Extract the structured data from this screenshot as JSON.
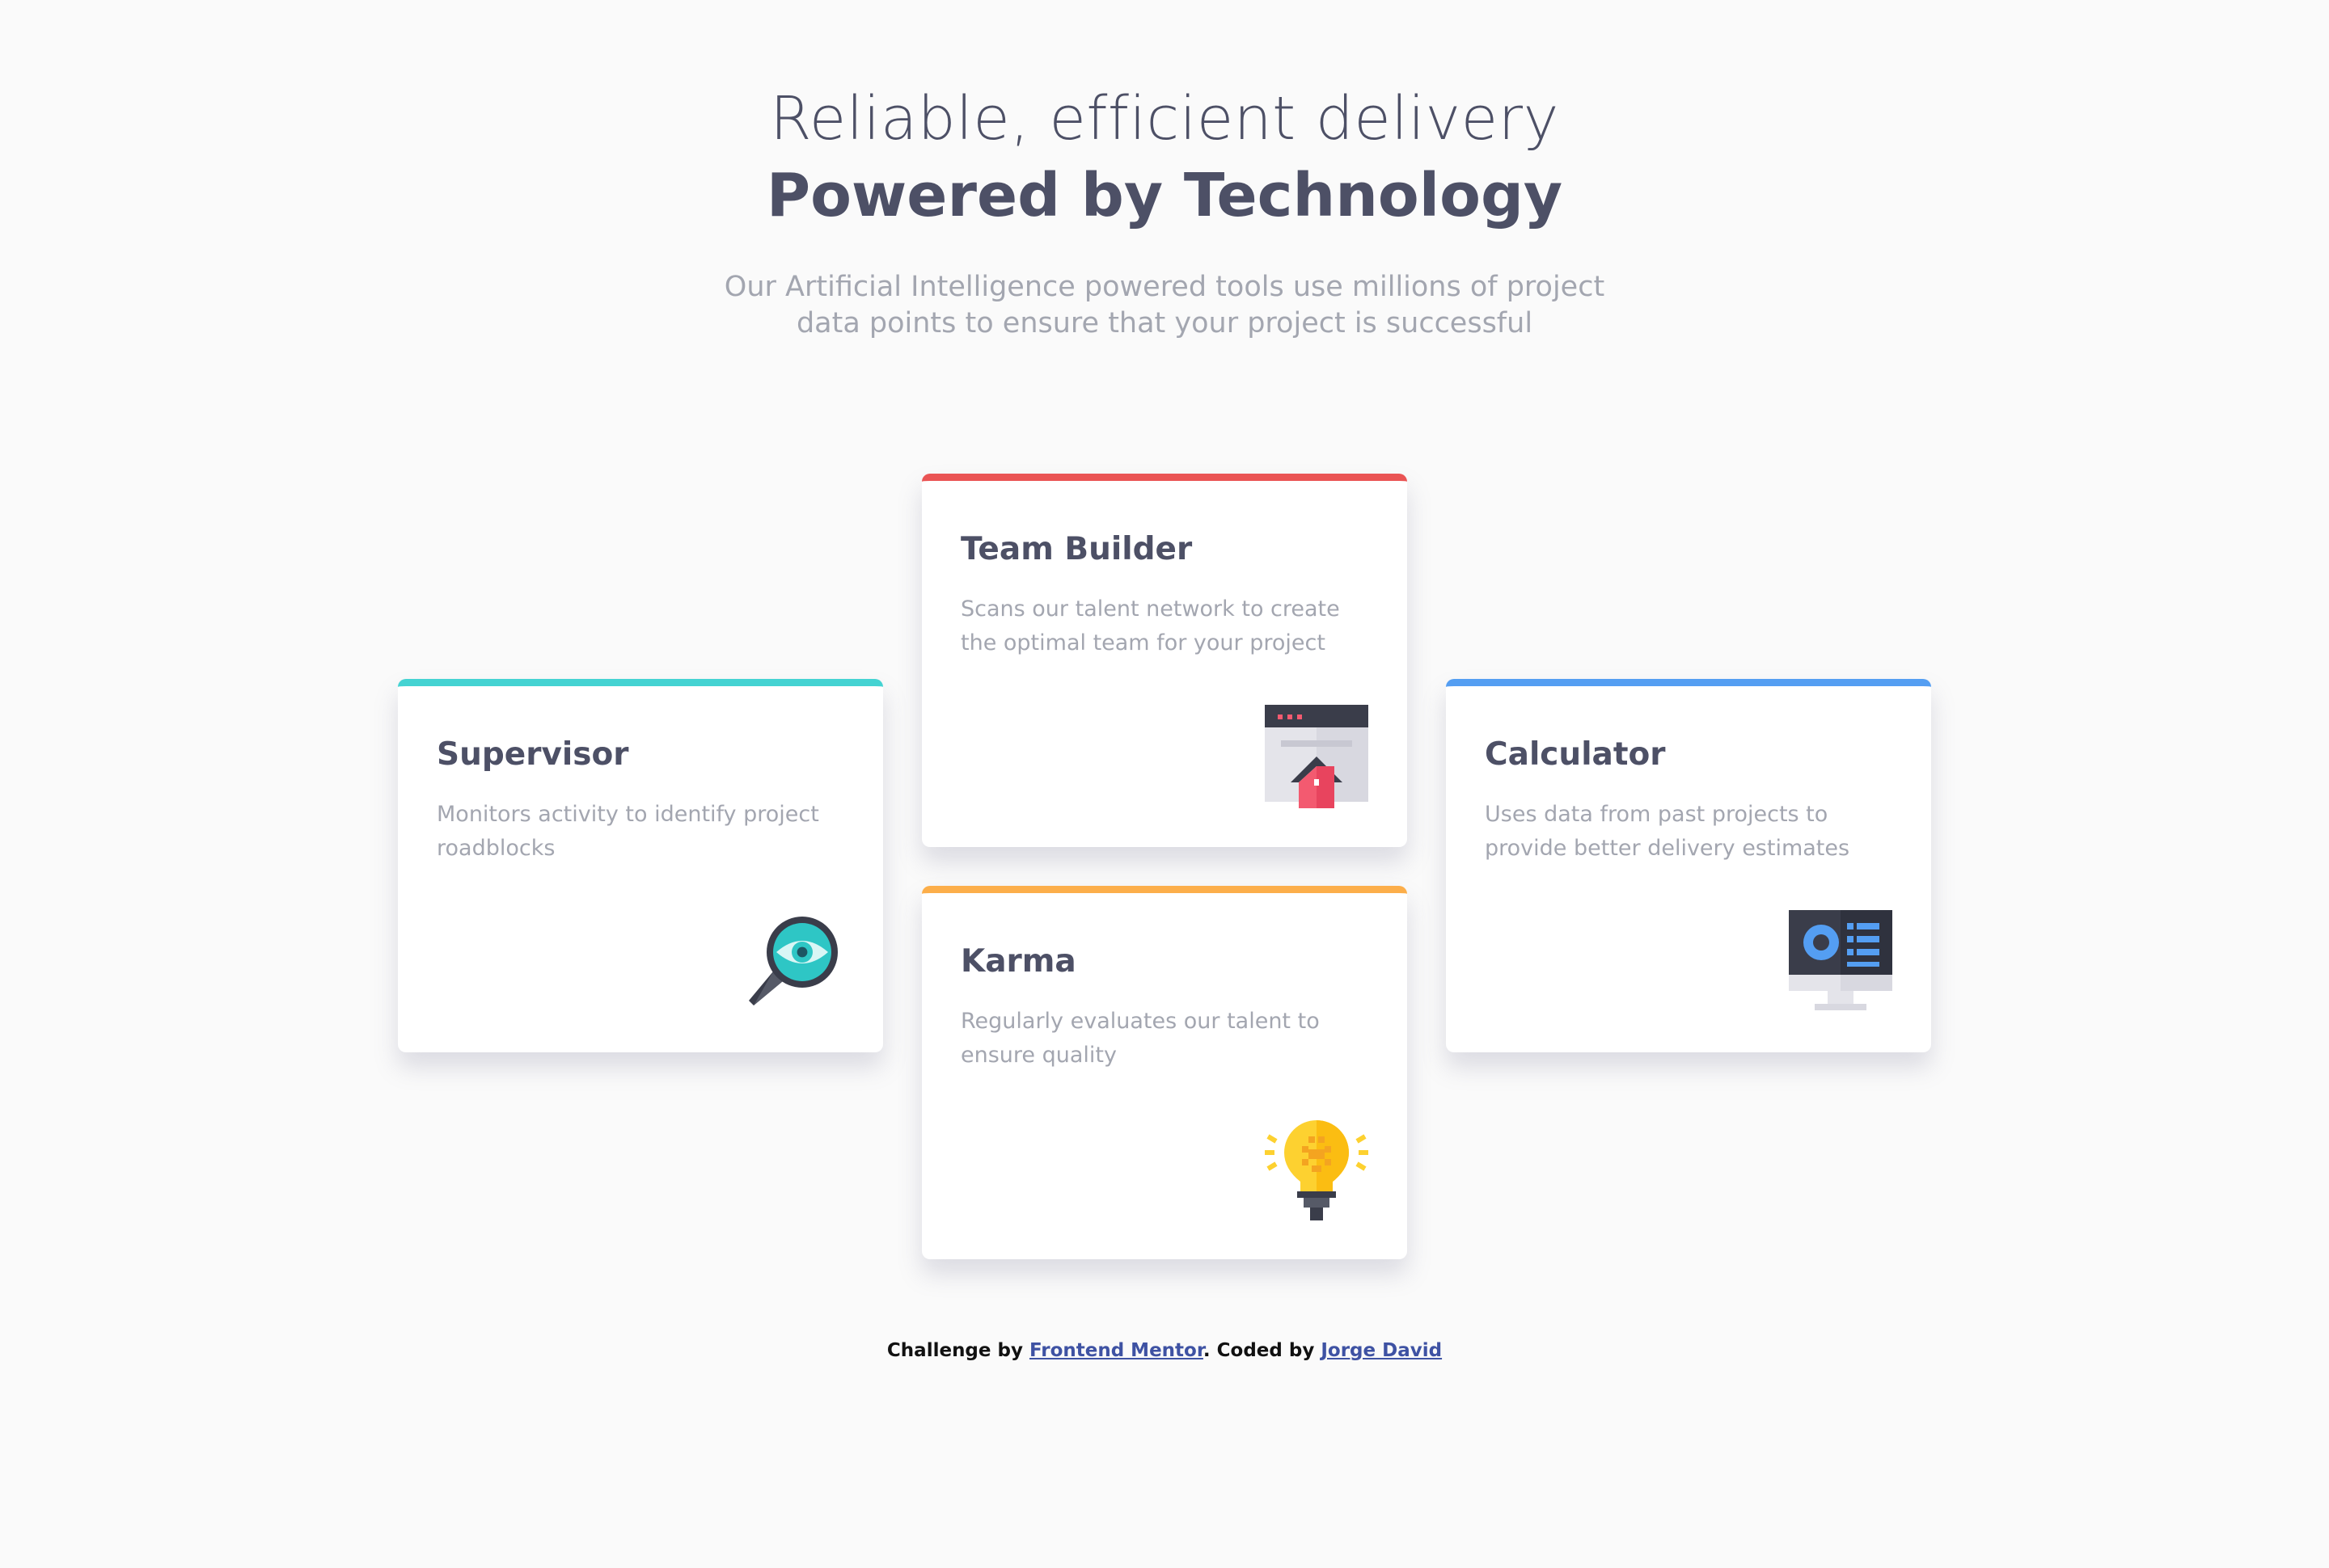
{
  "header": {
    "line1": "Reliable, efficient delivery",
    "line2": "Powered by Technology",
    "intro": "Our Artificial Intelligence powered tools use millions of project data points to ensure that your project is successful"
  },
  "cards": {
    "supervisor": {
      "title": "Supervisor",
      "description": "Monitors activity to identify project roadblocks",
      "icon": "magnifier-eye-icon",
      "accent": "#44d3d2"
    },
    "team_builder": {
      "title": "Team Builder",
      "description": "Scans our talent network to create the optimal team for your project",
      "icon": "window-house-icon",
      "accent": "#ea5454"
    },
    "karma": {
      "title": "Karma",
      "description": "Regularly evaluates our talent to ensure quality",
      "icon": "lightbulb-icon",
      "accent": "#fcae4a"
    },
    "calculator": {
      "title": "Calculator",
      "description": "Uses data from past projects to provide better delivery estimates",
      "icon": "monitor-dashboard-icon",
      "accent": "#549ef2"
    }
  },
  "footer": {
    "prefix": "Challenge by ",
    "link1": "Frontend Mentor",
    "middle": ". Coded by ",
    "link2": "Jorge David"
  }
}
